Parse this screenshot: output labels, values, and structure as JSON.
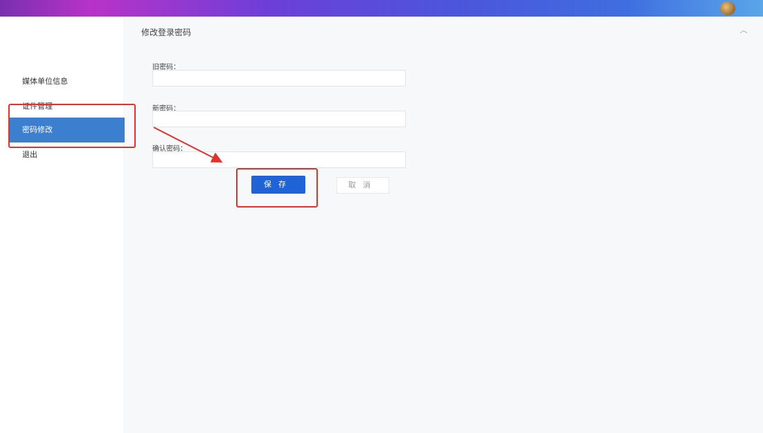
{
  "header": {
    "avatar_icon": "user-avatar"
  },
  "panel": {
    "title": "修改登录密码",
    "collapse_icon": "chevron-up-icon"
  },
  "sidebar": {
    "items": [
      {
        "label": "媒体单位信息"
      },
      {
        "label": "证件管理"
      },
      {
        "label": "密码修改",
        "active": true
      },
      {
        "label": "退出"
      }
    ]
  },
  "form": {
    "old_password_label": "旧密码：",
    "old_password_value": "",
    "new_password_label": "新密码：",
    "new_password_value": "",
    "confirm_password_label": "确认密码：",
    "confirm_password_value": "",
    "save_label": "保存",
    "cancel_label": "取消"
  },
  "annotations": {
    "highlight_color": "#e0322b"
  }
}
